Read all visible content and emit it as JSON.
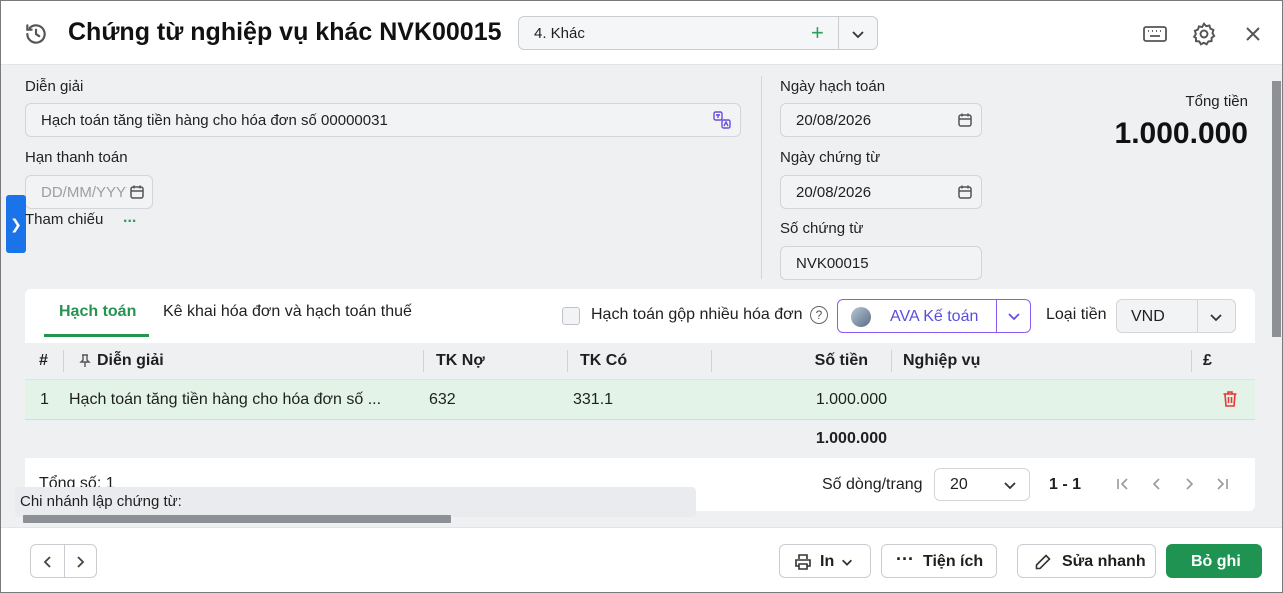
{
  "header": {
    "title": "Chứng từ nghiệp vụ khác NVK00015",
    "type_value": "4. Khác"
  },
  "form": {
    "description_label": "Diễn giải",
    "description_value": "Hạch toán tăng tiền hàng cho hóa đơn số 00000031",
    "due_date_label": "Hạn thanh toán",
    "due_date_placeholder": "DD/MM/YYYY",
    "reference_label": "Tham chiếu",
    "reference_more": "...",
    "posting_date_label": "Ngày hạch toán",
    "posting_date_value": "20/08/2026",
    "voucher_date_label": "Ngày chứng từ",
    "voucher_date_value": "20/08/2026",
    "voucher_no_label": "Số chứng từ",
    "voucher_no_value": "NVK00015",
    "total_label": "Tổng tiền",
    "total_value": "1.000.000"
  },
  "panel": {
    "tabs": [
      {
        "label": "Hạch toán",
        "active": true
      },
      {
        "label": "Kê khai hóa đơn và hạch toán thuế",
        "active": false
      }
    ],
    "merge_label": "Hạch toán gộp nhiều hóa đơn",
    "help_glyph": "?",
    "ava_label": "AVA Kế toán",
    "currency_label": "Loại tiền",
    "currency_value": "VND",
    "columns": [
      "#",
      "Diễn giải",
      "TK Nợ",
      "TK Có",
      "Số tiền",
      "Nghiệp vụ",
      "£"
    ],
    "rows": [
      {
        "no": "1",
        "desc": "Hạch toán tăng tiền hàng cho hóa đơn số ...",
        "debit": "632",
        "credit": "331.1",
        "amount": "1.000.000",
        "business": ""
      }
    ],
    "sum_amount": "1.000.000",
    "total_count_label": "Tổng số: 1",
    "rows_per_page_label": "Số dòng/trang",
    "rows_per_page_value": "20",
    "page_range": "1 - 1"
  },
  "branch_label": "Chi nhánh lập chứng từ:",
  "footer": {
    "print_label": "In",
    "utility_label": "Tiện ích",
    "quick_edit_label": "Sửa nhanh",
    "unpost_label": "Bỏ ghi"
  },
  "colors": {
    "accent_green": "#1f9351",
    "ava_purple": "#8a5cf5",
    "side_tab_blue": "#1a73e8",
    "delete_red": "#e53935"
  }
}
